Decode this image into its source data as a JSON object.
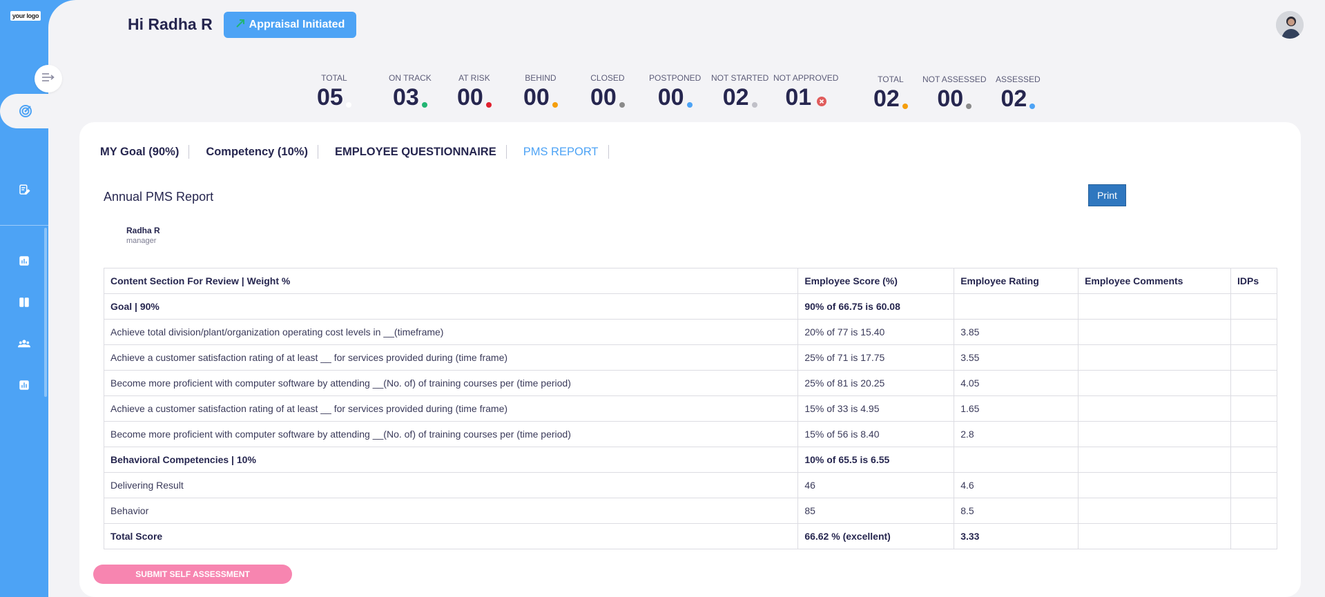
{
  "logo": {
    "text": "your logo"
  },
  "header": {
    "greeting": "Hi Radha R",
    "status_label": "Appraisal Initiated"
  },
  "stats": [
    {
      "label": "TOTAL",
      "value": "05",
      "color": "#ffffff"
    },
    {
      "label": "ON TRACK",
      "value": "03",
      "color": "#22b573"
    },
    {
      "label": "AT RISK",
      "value": "00",
      "color": "#e0202e"
    },
    {
      "label": "BEHIND",
      "value": "00",
      "color": "#f59e0b"
    },
    {
      "label": "CLOSED",
      "value": "00",
      "color": "#8a8a8a"
    },
    {
      "label": "POSTPONED",
      "value": "00",
      "color": "#4da3f5"
    },
    {
      "label": "NOT STARTED",
      "value": "02",
      "color": "#c0c0c8"
    },
    {
      "label": "NOT APPROVED",
      "value": "01",
      "color": "#e05c5c"
    },
    {
      "label": "TOTAL",
      "value": "02",
      "color": "#f59e0b"
    },
    {
      "label": "NOT ASSESSED",
      "value": "00",
      "color": "#8a8a8a"
    },
    {
      "label": "ASSESSED",
      "value": "02",
      "color": "#4da3f5"
    }
  ],
  "tabs": [
    {
      "label": "MY Goal (90%)"
    },
    {
      "label": "Competency (10%)"
    },
    {
      "label": "EMPLOYEE QUESTIONNAIRE"
    },
    {
      "label": "PMS REPORT"
    }
  ],
  "report": {
    "title": "Annual PMS Report",
    "print_label": "Print",
    "employee_name": "Radha R",
    "employee_role": "manager",
    "columns": [
      "Content Section For Review | Weight %",
      "Employee Score (%)",
      "Employee Rating",
      "Employee Comments",
      "IDPs"
    ],
    "rows": [
      [
        "Goal | 90%",
        "90% of 66.75 is 60.08",
        "",
        "",
        ""
      ],
      [
        "Achieve total division/plant/organization operating cost levels in __(timeframe)",
        "20% of 77 is 15.40",
        "3.85",
        "",
        ""
      ],
      [
        "Achieve a customer satisfaction rating of at least __ for services provided during (time frame)",
        "25% of 71 is 17.75",
        "3.55",
        "",
        ""
      ],
      [
        "Become more proficient with computer software by attending __(No. of) of training courses per (time period)",
        "25% of 81 is 20.25",
        "4.05",
        "",
        ""
      ],
      [
        "Achieve a customer satisfaction rating of at least __ for services provided during (time frame)",
        "15% of 33 is 4.95",
        "1.65",
        "",
        ""
      ],
      [
        "Become more proficient with computer software by attending __(No. of) of training courses per (time period)",
        "15% of 56 is 8.40",
        "2.8",
        "",
        ""
      ],
      [
        "Behavioral Competencies | 10%",
        "10% of 65.5 is 6.55",
        "",
        "",
        ""
      ],
      [
        "Delivering Result",
        "46",
        "4.6",
        "",
        ""
      ],
      [
        "Behavior",
        "85",
        "8.5",
        "",
        ""
      ],
      [
        "Total Score",
        "66.62 % (excellent)",
        "3.33",
        "",
        ""
      ]
    ]
  },
  "submit_label": "SUBMIT SELF ASSESSMENT"
}
